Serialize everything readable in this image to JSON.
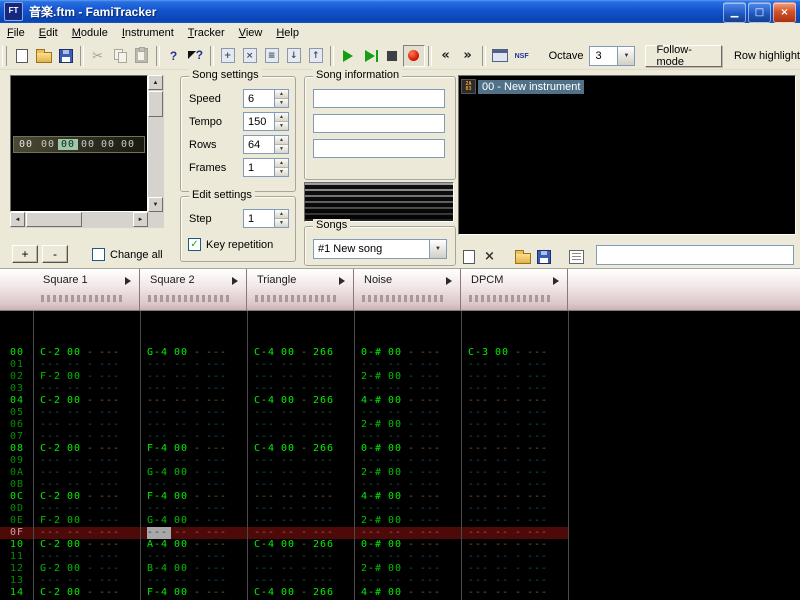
{
  "window": {
    "title": "音楽.ftm - FamiTracker",
    "icon_text": "FT",
    "controls": [
      {
        "name": "minimize",
        "glyph": "▁"
      },
      {
        "name": "maximize",
        "glyph": "□"
      },
      {
        "name": "close",
        "glyph": "×"
      }
    ]
  },
  "menu_bar": {
    "items": [
      "File",
      "Edit",
      "Module",
      "Instrument",
      "Tracker",
      "View",
      "Help"
    ]
  },
  "toolbar": {
    "buttons": [
      {
        "icon": "new-file",
        "enabled": true
      },
      {
        "icon": "open-file",
        "enabled": true
      },
      {
        "icon": "save-file",
        "enabled": true
      },
      {
        "icon": "separator"
      },
      {
        "icon": "cut",
        "enabled": false
      },
      {
        "icon": "copy",
        "enabled": false
      },
      {
        "icon": "paste",
        "enabled": false
      },
      {
        "icon": "separator"
      },
      {
        "icon": "about",
        "enabled": true
      },
      {
        "icon": "context-help",
        "enabled": true
      },
      {
        "icon": "separator"
      },
      {
        "icon": "add-frame",
        "enabled": true
      },
      {
        "icon": "remove-frame",
        "enabled": true
      },
      {
        "icon": "clone-frame",
        "enabled": true
      },
      {
        "icon": "move-frame-down",
        "enabled": true
      },
      {
        "icon": "move-frame-up",
        "enabled": true
      },
      {
        "icon": "separator"
      },
      {
        "icon": "play",
        "enabled": true
      },
      {
        "icon": "play-pattern",
        "enabled": true
      },
      {
        "icon": "stop",
        "enabled": true
      },
      {
        "icon": "edit-mode",
        "enabled": true,
        "active": true
      },
      {
        "icon": "separator"
      },
      {
        "icon": "prev-frame",
        "enabled": true
      },
      {
        "icon": "next-frame",
        "enabled": true
      },
      {
        "icon": "separator"
      },
      {
        "icon": "module-properties",
        "enabled": true
      },
      {
        "icon": "create-nsf",
        "enabled": true
      }
    ],
    "octave_label": "Octave",
    "octave_value": "3",
    "follow_mode_label": "Follow-mode",
    "row_highlight_label": "Row highlight"
  },
  "frame_editor": {
    "rows": [
      {
        "frame": "00",
        "patterns": [
          "00",
          "00",
          "00",
          "00",
          "00"
        ],
        "selected_channel": 1
      }
    ],
    "add_button_label": "+",
    "remove_button_label": "-",
    "change_all_label": "Change all",
    "change_all_checked": false
  },
  "song_settings": {
    "title": "Song settings",
    "fields": [
      {
        "name": "speed",
        "label": "Speed",
        "value": "6"
      },
      {
        "name": "tempo",
        "label": "Tempo",
        "value": "150"
      },
      {
        "name": "rows",
        "label": "Rows",
        "value": "64"
      },
      {
        "name": "frames",
        "label": "Frames",
        "value": "1"
      }
    ]
  },
  "edit_settings": {
    "title": "Edit settings",
    "fields": [
      {
        "name": "step",
        "label": "Step",
        "value": "1"
      }
    ],
    "key_repetition_label": "Key repetition",
    "key_repetition_checked": true
  },
  "song_information": {
    "title": "Song information",
    "fields": [
      "",
      "",
      ""
    ]
  },
  "songs": {
    "title": "Songs",
    "selected_song": "#1 New song"
  },
  "instruments": {
    "items": [
      {
        "label": "00 - New instrument",
        "chip": "2A03",
        "selected": true
      }
    ],
    "toolbar": [
      "new-instrument",
      "remove-instrument",
      "load-instrument",
      "save-instrument",
      "edit-instrument"
    ],
    "name_field_value": ""
  },
  "pattern": {
    "channels": [
      "Square 1",
      "Square 2",
      "Triangle",
      "Noise",
      "DPCM"
    ],
    "current_row": "0F",
    "cursor": {
      "row": "0F",
      "channel": 1
    },
    "rows": [
      {
        "n": "00",
        "cells": [
          {
            "note": "C-2",
            "inst": "00"
          },
          {
            "note": "G-4",
            "inst": "00"
          },
          {
            "note": "C-4",
            "inst": "00",
            "fx": "266"
          },
          {
            "note": "0-#",
            "inst": "00"
          },
          {
            "note": "C-3",
            "inst": "00"
          }
        ]
      },
      {
        "n": "01",
        "cells": [
          null,
          null,
          null,
          null,
          null
        ]
      },
      {
        "n": "02",
        "cells": [
          {
            "note": "F-2",
            "inst": "00"
          },
          null,
          null,
          {
            "note": "2-#",
            "inst": "00"
          },
          null
        ]
      },
      {
        "n": "03",
        "cells": [
          null,
          null,
          null,
          null,
          null
        ]
      },
      {
        "n": "04",
        "cells": [
          {
            "note": "C-2",
            "inst": "00"
          },
          null,
          {
            "note": "C-4",
            "inst": "00",
            "fx": "266"
          },
          {
            "note": "4-#",
            "inst": "00"
          },
          null
        ]
      },
      {
        "n": "05",
        "cells": [
          null,
          null,
          null,
          null,
          null
        ]
      },
      {
        "n": "06",
        "cells": [
          null,
          null,
          null,
          {
            "note": "2-#",
            "inst": "00"
          },
          null
        ]
      },
      {
        "n": "07",
        "cells": [
          null,
          null,
          null,
          null,
          null
        ]
      },
      {
        "n": "08",
        "cells": [
          {
            "note": "C-2",
            "inst": "00"
          },
          {
            "note": "F-4",
            "inst": "00"
          },
          {
            "note": "C-4",
            "inst": "00",
            "fx": "266"
          },
          {
            "note": "0-#",
            "inst": "00"
          },
          null
        ]
      },
      {
        "n": "09",
        "cells": [
          null,
          null,
          null,
          null,
          null
        ]
      },
      {
        "n": "0A",
        "cells": [
          null,
          {
            "note": "G-4",
            "inst": "00"
          },
          null,
          {
            "note": "2-#",
            "inst": "00"
          },
          null
        ]
      },
      {
        "n": "0B",
        "cells": [
          null,
          null,
          null,
          null,
          null
        ]
      },
      {
        "n": "0C",
        "cells": [
          {
            "note": "C-2",
            "inst": "00"
          },
          {
            "note": "F-4",
            "inst": "00"
          },
          null,
          {
            "note": "4-#",
            "inst": "00"
          },
          null
        ]
      },
      {
        "n": "0D",
        "cells": [
          null,
          null,
          null,
          null,
          null
        ]
      },
      {
        "n": "0E",
        "cells": [
          {
            "note": "F-2",
            "inst": "00"
          },
          {
            "note": "G-4",
            "inst": "00"
          },
          null,
          {
            "note": "2-#",
            "inst": "00"
          },
          null
        ]
      },
      {
        "n": "0F",
        "cells": [
          null,
          null,
          null,
          null,
          null
        ]
      },
      {
        "n": "10",
        "cells": [
          {
            "note": "C-2",
            "inst": "00"
          },
          {
            "note": "A-4",
            "inst": "00"
          },
          {
            "note": "C-4",
            "inst": "00",
            "fx": "266"
          },
          {
            "note": "0-#",
            "inst": "00"
          },
          null
        ]
      },
      {
        "n": "11",
        "cells": [
          null,
          null,
          null,
          null,
          null
        ]
      },
      {
        "n": "12",
        "cells": [
          {
            "note": "G-2",
            "inst": "00"
          },
          {
            "note": "B-4",
            "inst": "00"
          },
          null,
          {
            "note": "2-#",
            "inst": "00"
          },
          null
        ]
      },
      {
        "n": "13",
        "cells": [
          null,
          null,
          null,
          null,
          null
        ]
      },
      {
        "n": "14",
        "cells": [
          {
            "note": "C-2",
            "inst": "00"
          },
          {
            "note": "F-4",
            "inst": "00"
          },
          {
            "note": "C-4",
            "inst": "00",
            "fx": "266"
          },
          {
            "note": "4-#",
            "inst": "00"
          },
          null
        ]
      }
    ]
  }
}
